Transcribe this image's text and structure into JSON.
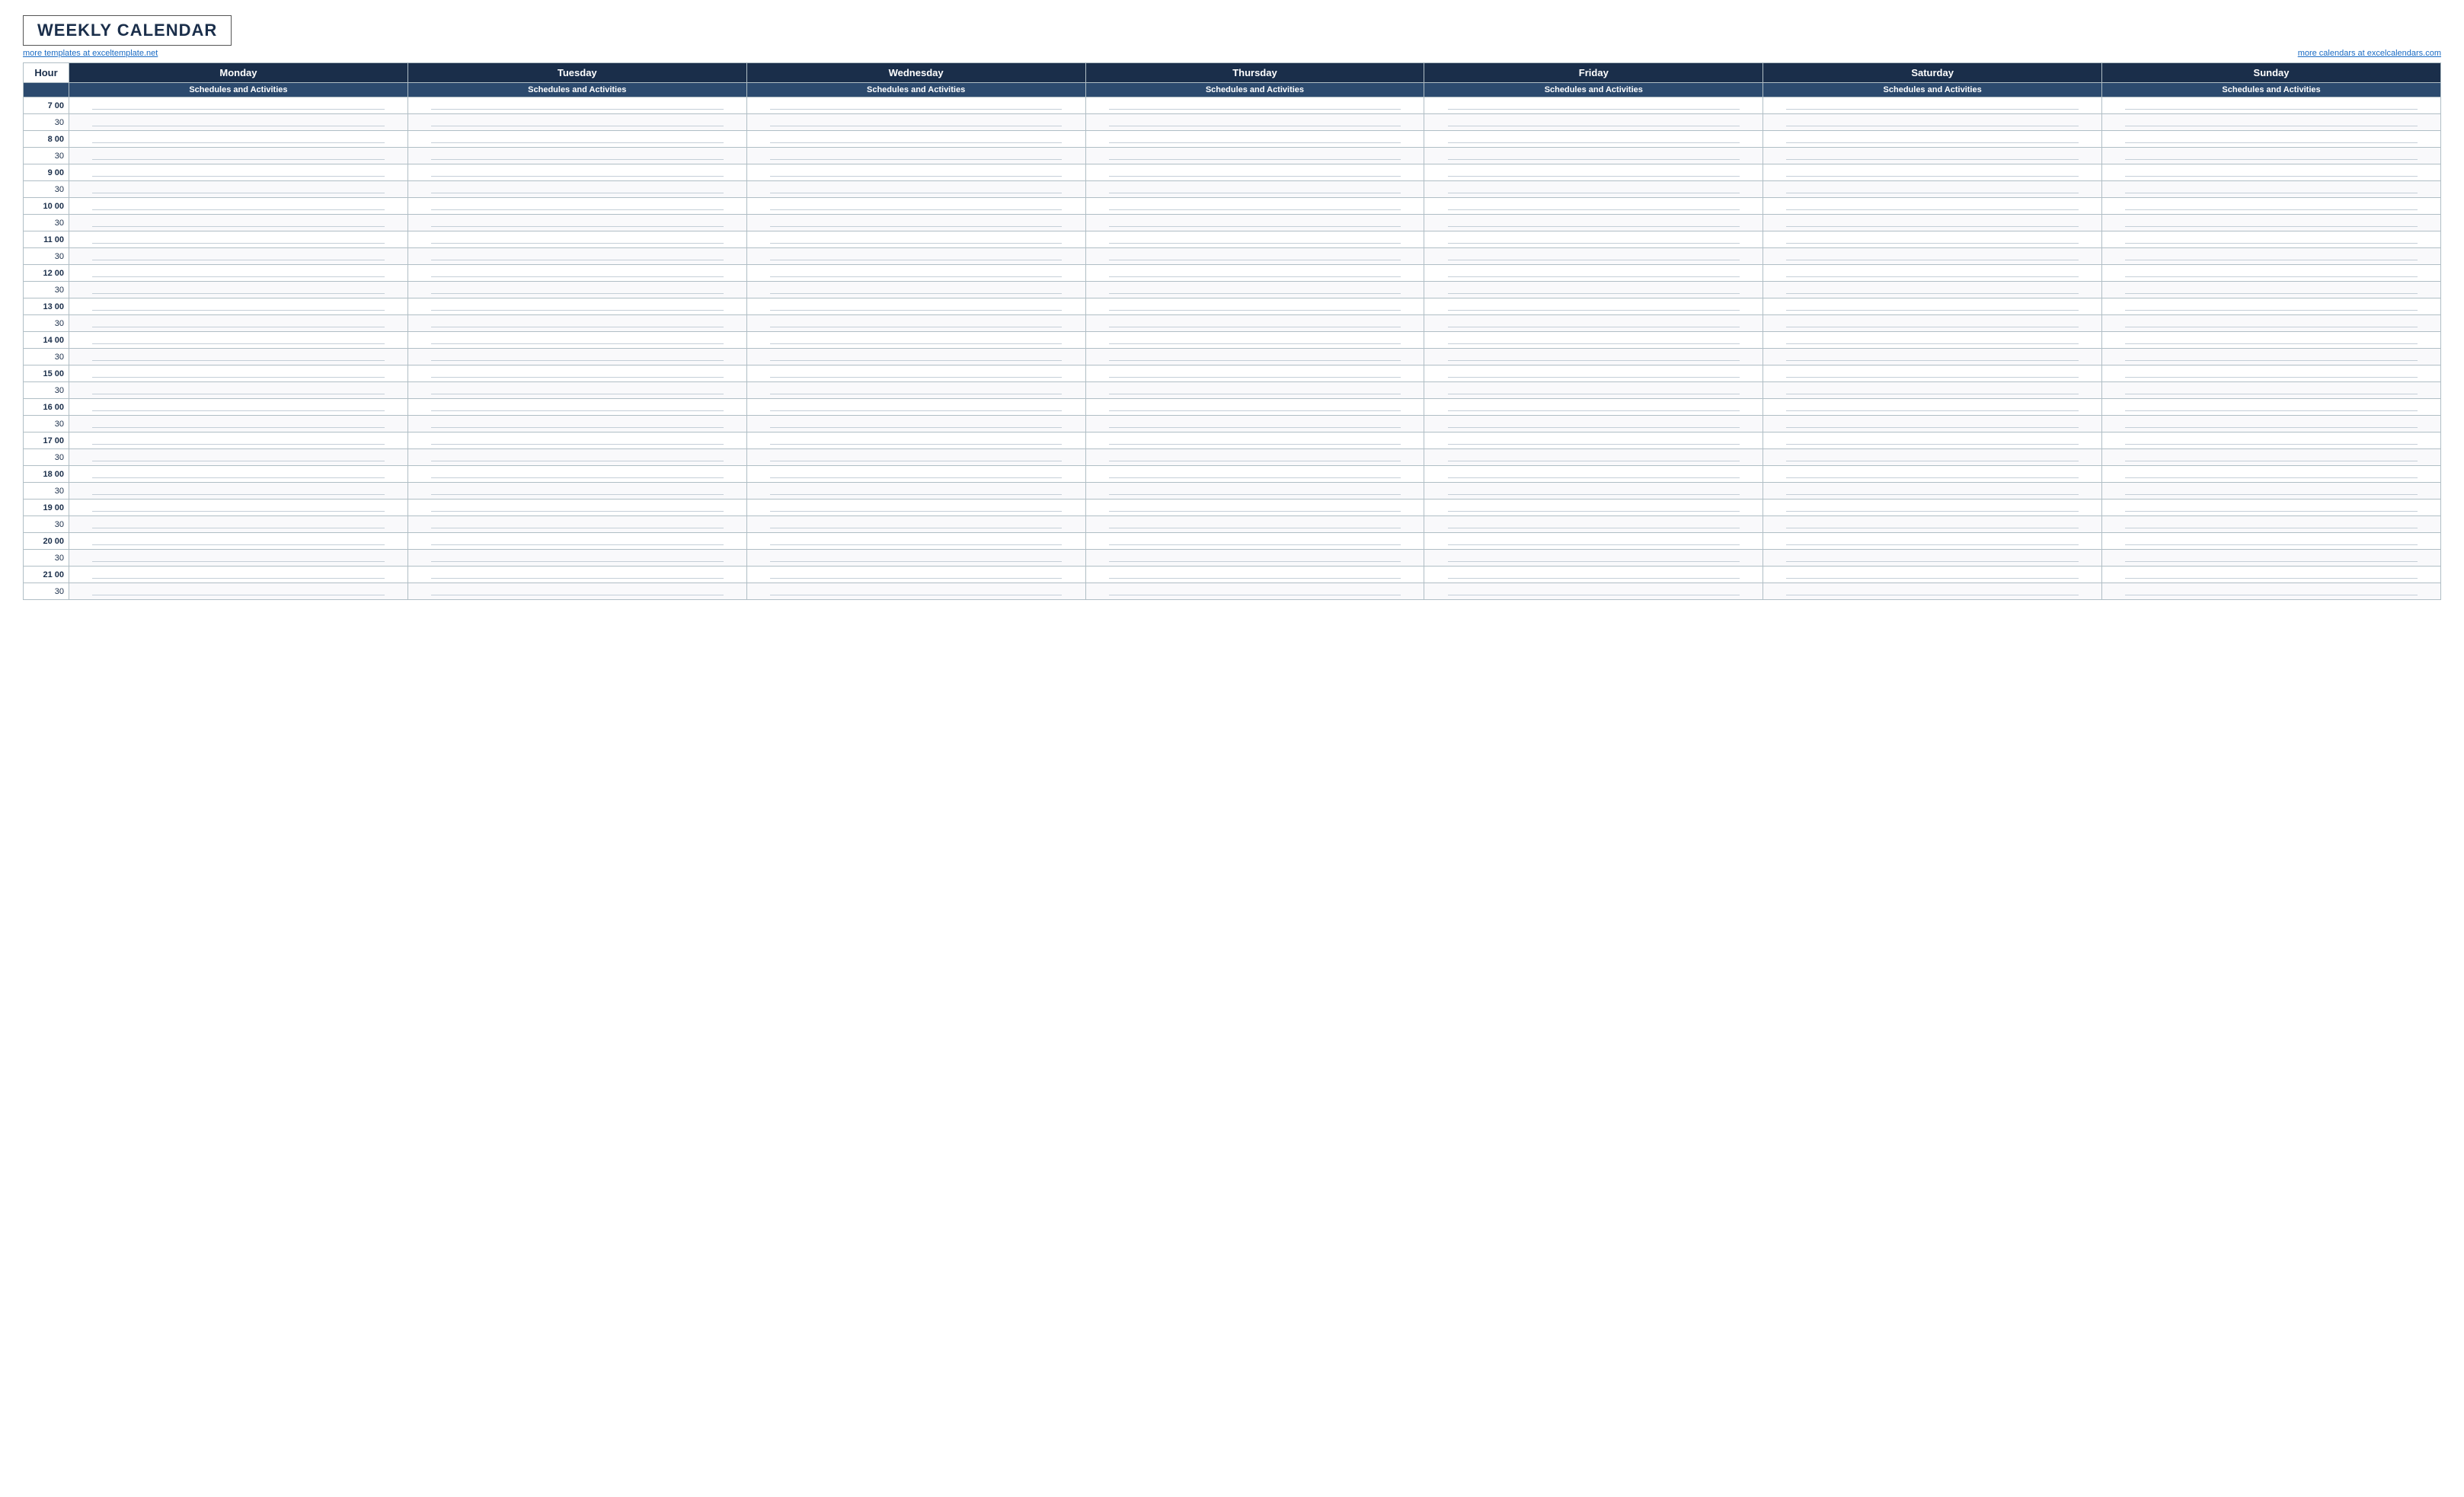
{
  "header": {
    "title": "WEEKLY CALENDAR",
    "link_left": "more templates at exceltemplate.net",
    "link_right": "more calendars at excelcalendars.com"
  },
  "columns": {
    "hour_label": "Hour",
    "days": [
      "Monday",
      "Tuesday",
      "Wednesday",
      "Thursday",
      "Friday",
      "Saturday",
      "Sunday"
    ],
    "subheader": "Schedules and Activities"
  },
  "time_slots": [
    {
      "hour": "7  00",
      "half": "30"
    },
    {
      "hour": "8  00",
      "half": "30"
    },
    {
      "hour": "9  00",
      "half": "30"
    },
    {
      "hour": "10  00",
      "half": "30"
    },
    {
      "hour": "11  00",
      "half": "30"
    },
    {
      "hour": "12  00",
      "half": "30"
    },
    {
      "hour": "13  00",
      "half": "30"
    },
    {
      "hour": "14  00",
      "half": "30"
    },
    {
      "hour": "15  00",
      "half": "30"
    },
    {
      "hour": "16  00",
      "half": "30"
    },
    {
      "hour": "17  00",
      "half": "30"
    },
    {
      "hour": "18  00",
      "half": "30"
    },
    {
      "hour": "19  00",
      "half": "30"
    },
    {
      "hour": "20  00",
      "half": "30"
    },
    {
      "hour": "21  00",
      "half": "30"
    }
  ]
}
